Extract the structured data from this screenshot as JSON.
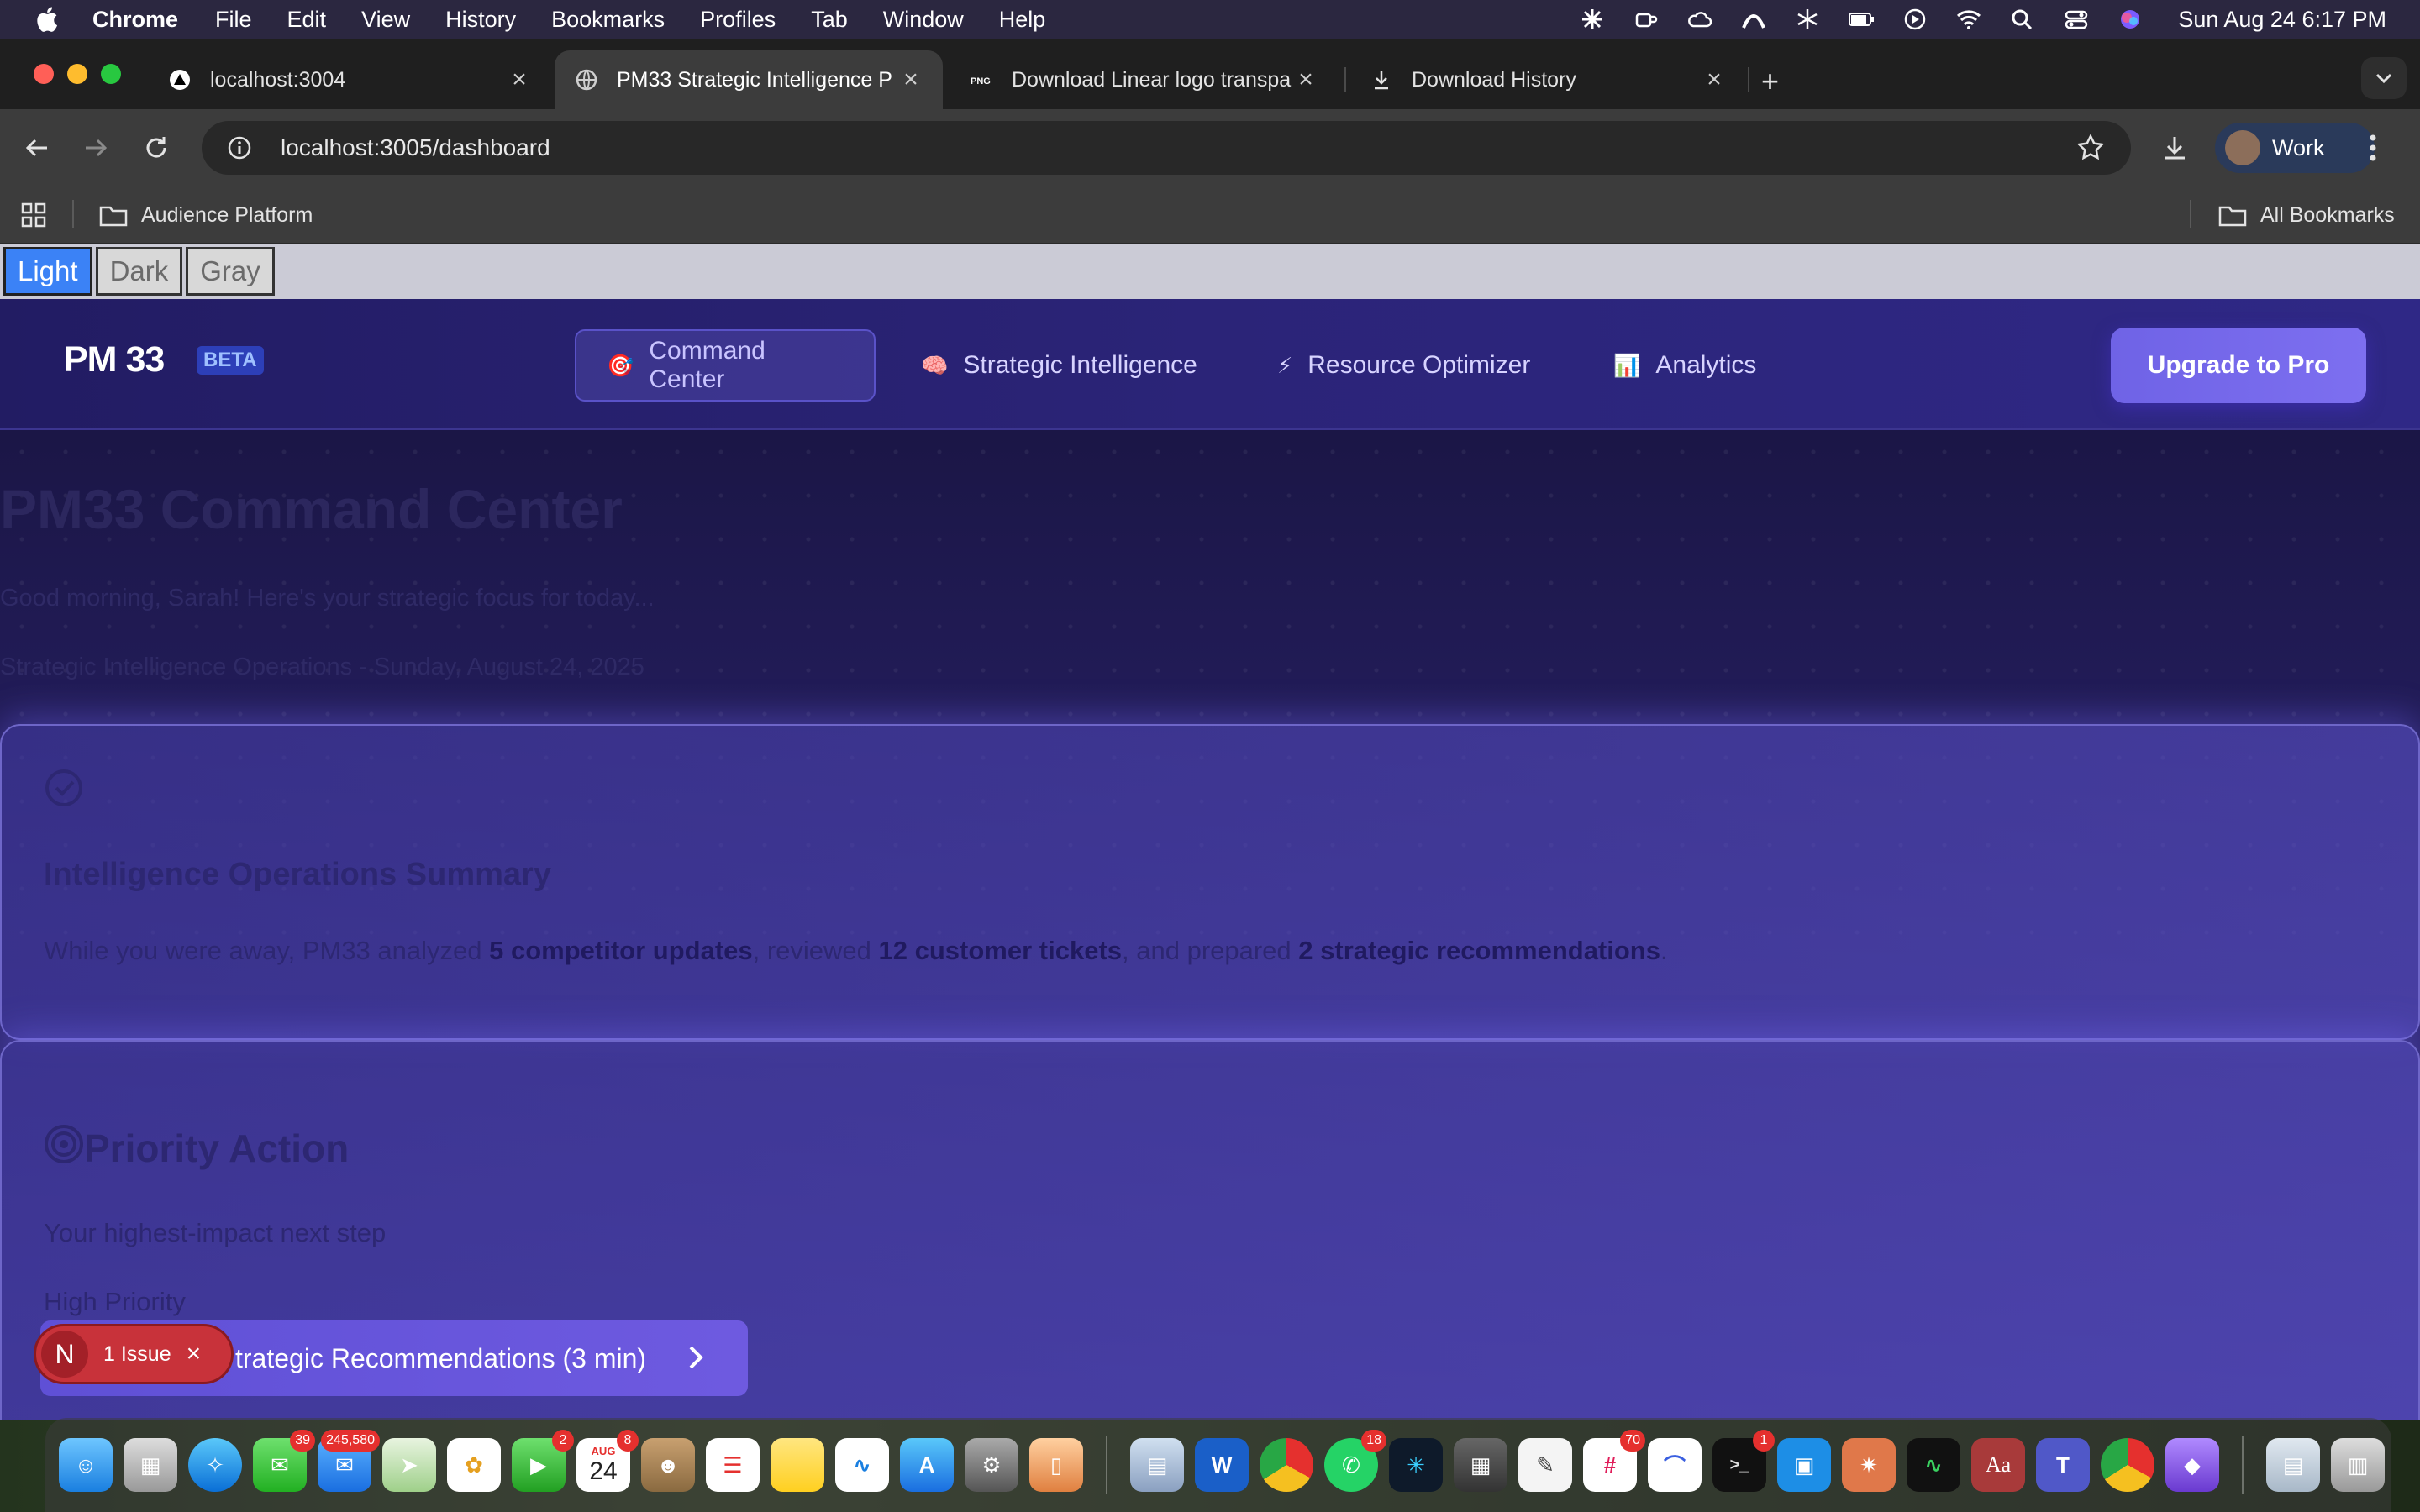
{
  "menubar": {
    "app": "Chrome",
    "items": [
      "File",
      "Edit",
      "View",
      "History",
      "Bookmarks",
      "Profiles",
      "Tab",
      "Window",
      "Help"
    ],
    "clock": "Sun Aug 24  6:17 PM"
  },
  "tabs": [
    {
      "title": "localhost:3004",
      "icon": "vercel-triangle-icon"
    },
    {
      "title": "PM33 Strategic Intelligence P",
      "icon": "globe-icon"
    },
    {
      "title": "Download Linear logo transpa",
      "icon": "png-icon"
    },
    {
      "title": "Download History",
      "icon": "download-icon"
    }
  ],
  "toolbar": {
    "url": "localhost:3005/dashboard",
    "profile": "Work"
  },
  "bookmarks": {
    "left": "Audience Platform",
    "right": "All Bookmarks"
  },
  "theme_switcher": {
    "options": [
      "Light",
      "Dark",
      "Gray"
    ],
    "active": "Light"
  },
  "app": {
    "logo": "PM 33",
    "badge": "BETA",
    "nav": [
      {
        "icon": "🎯",
        "label": "Command Center",
        "active": true
      },
      {
        "icon": "🧠",
        "label": "Strategic Intelligence",
        "active": false
      },
      {
        "icon": "⚡",
        "label": "Resource Optimizer",
        "active": false
      },
      {
        "icon": "📊",
        "label": "Analytics",
        "active": false
      }
    ],
    "upgrade": "Upgrade to Pro"
  },
  "hero": {
    "title": "PM33 Command Center",
    "subtitle": "Good morning, Sarah! Here's your strategic focus for today...",
    "date": "Strategic Intelligence Operations - Sunday, August 24, 2025"
  },
  "summary_card": {
    "title": "Intelligence Operations Summary",
    "text_prefix": "While you were away, PM33 analyzed ",
    "bold1": "5 competitor updates",
    "text_mid1": ", reviewed ",
    "bold2": "12 customer tickets",
    "text_mid2": ", and prepared ",
    "bold3": "2 strategic recommendations",
    "text_end": "."
  },
  "priority_card": {
    "title": "Priority Action",
    "subtitle": "Your highest-impact next step",
    "priority": "High Priority",
    "cta": "trategic Recommendations (3 min)"
  },
  "issue_badge": {
    "letter": "N",
    "label": "1 Issue"
  },
  "dock": {
    "badges": {
      "messages": "39",
      "mail": "245,580",
      "facetime": "2",
      "calendar": "8",
      "whatsapp": "18",
      "slack": "70",
      "terminal": "1"
    },
    "calendar_month": "AUG",
    "calendar_day": "24"
  }
}
